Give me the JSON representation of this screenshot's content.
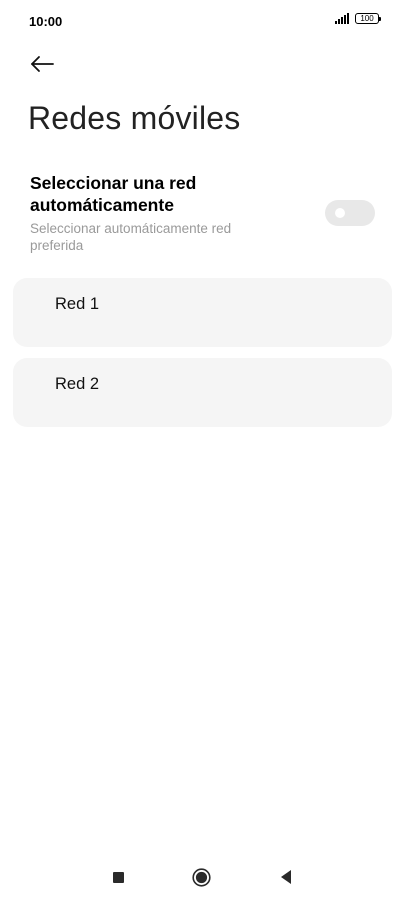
{
  "status_bar": {
    "time": "10:00",
    "battery_level": "100",
    "icons": [
      "signal-icon",
      "battery-icon"
    ]
  },
  "header": {
    "back_icon": "arrow-left-icon",
    "title": "Redes móviles"
  },
  "auto_select": {
    "title": "Seleccionar una red automáticamente",
    "subtitle": "Seleccionar automáticamente red preferida",
    "enabled": false
  },
  "networks": [
    {
      "label": "Red 1"
    },
    {
      "label": "Red 2"
    }
  ],
  "nav_bar": {
    "icons": [
      "recents-square-icon",
      "home-circle-icon",
      "back-triangle-icon"
    ]
  },
  "colors": {
    "background": "#ffffff",
    "card": "#f5f5f5",
    "toggle_off": "#e8e8e8",
    "subtitle": "#9a9a9a"
  }
}
